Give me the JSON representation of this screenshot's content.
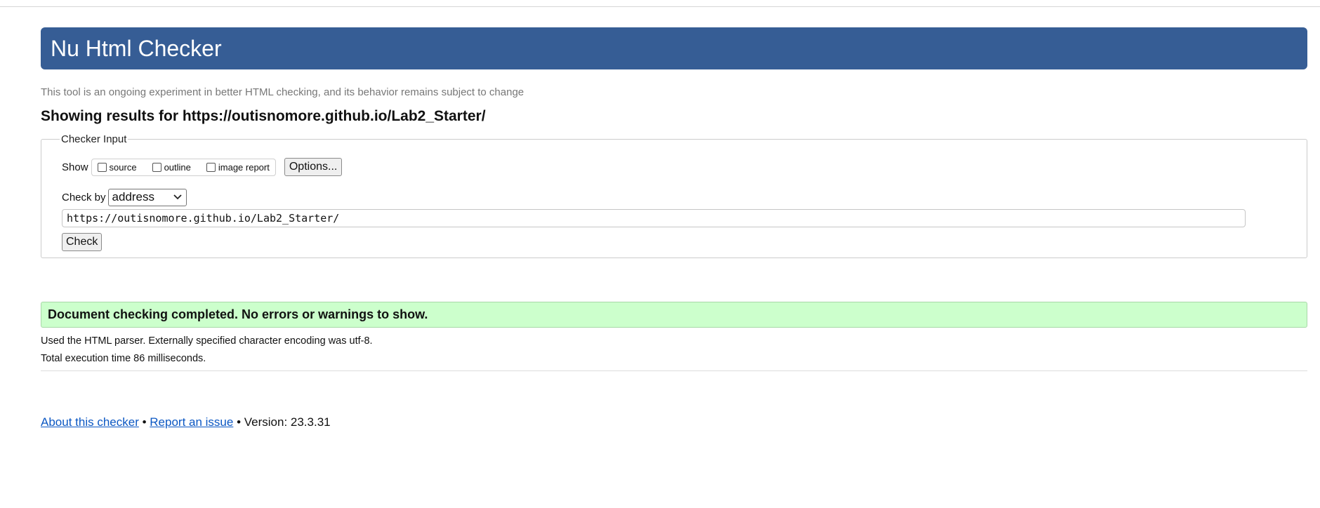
{
  "banner": {
    "title": "Nu Html Checker"
  },
  "tagline": "This tool is an ongoing experiment in better HTML checking, and its behavior remains subject to change",
  "results": {
    "prefix": "Showing results for ",
    "url": "https://outisnomore.github.io/Lab2_Starter/"
  },
  "checker_input": {
    "legend": "Checker Input",
    "show_label": "Show",
    "show_options": [
      {
        "label": "source",
        "checked": false
      },
      {
        "label": "outline",
        "checked": false
      },
      {
        "label": "image report",
        "checked": false
      }
    ],
    "options_button": "Options...",
    "check_by_label": "Check by",
    "check_by_value": "address",
    "url_value": "https://outisnomore.github.io/Lab2_Starter/",
    "check_button": "Check"
  },
  "status": {
    "message": "Document checking completed. No errors or warnings to show."
  },
  "details": {
    "parser": "Used the HTML parser. Externally specified character encoding was utf-8.",
    "time": "Total execution time 86 milliseconds."
  },
  "footer": {
    "about_link": "About this checker",
    "separator": " • ",
    "report_link": "Report an issue",
    "version": "Version: 23.3.31"
  }
}
